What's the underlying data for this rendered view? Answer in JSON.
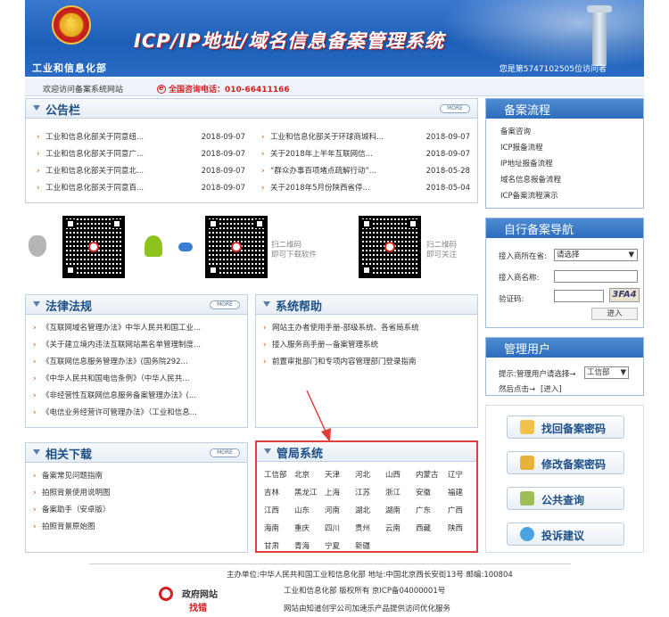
{
  "header": {
    "ministry": "工业和信息化部",
    "title": "ICP/IP地址/域名信息备案管理系统",
    "visitor": "您是第5747102505位访问者"
  },
  "welcome": {
    "text": "欢迎访问备案系统网站",
    "phone": "全国咨询电话：010-66411166"
  },
  "notice": {
    "title": "公告栏",
    "more": "MORE",
    "left": [
      {
        "t": "工业和信息化部关于同意纽...",
        "d": "2018-09-07"
      },
      {
        "t": "工业和信息化部关于同意广...",
        "d": "2018-09-07"
      },
      {
        "t": "工业和信息化部关于同意北...",
        "d": "2018-09-07"
      },
      {
        "t": "工业和信息化部关于同意百...",
        "d": "2018-09-07"
      }
    ],
    "right": [
      {
        "t": "工业和信息化部关于环球商城科...",
        "d": "2018-09-07"
      },
      {
        "t": "关于2018年上半年互联网信...",
        "d": "2018-09-07"
      },
      {
        "t": "“群众办事百项堵点疏解行动”...",
        "d": "2018-05-28"
      },
      {
        "t": "关于2018年5月份陕西省停...",
        "d": "2018-05-04"
      }
    ]
  },
  "qr": {
    "download_line1": "扫二维码",
    "download_line2": "即可下载软件",
    "follow_line1": "扫二维码",
    "follow_line2": "即可关注"
  },
  "law": {
    "title": "法律法规",
    "more": "MORE",
    "items": [
      "《互联网域名管理办法》中华人民共和国工业...",
      "《关于建立境内违法互联网站黑名单管理制度...",
      "《互联网信息服务管理办法》(国务院292...",
      "《中华人民共和国电信条例》（中华人民共...",
      "《非经营性互联网信息服务备案管理办法》(...",
      "《电信业务经营许可管理办法》（工业和信息..."
    ]
  },
  "help": {
    "title": "系统帮助",
    "items": [
      "网站主办者使用手册-部级系统、各省局系统",
      "接入服务商手册—备案管理系统",
      "前置审批部门和专项内容管理部门登录指南"
    ]
  },
  "download": {
    "title": "相关下载",
    "more": "MORE",
    "items": [
      "备案常见问题指南",
      "拍照背景使用说明图",
      "备案助手（安卓版）",
      "拍照背景原始图"
    ]
  },
  "bureau": {
    "title": "管局系统",
    "regions": [
      [
        "工信部",
        "北京",
        "天津",
        "河北",
        "山西",
        "内蒙古",
        "辽宁"
      ],
      [
        "吉林",
        "黑龙江",
        "上海",
        "江苏",
        "浙江",
        "安徽",
        "福建"
      ],
      [
        "江西",
        "山东",
        "河南",
        "湖北",
        "湖南",
        "广东",
        "广西"
      ],
      [
        "海南",
        "重庆",
        "四川",
        "贵州",
        "云南",
        "西藏",
        "陕西"
      ],
      [
        "甘肃",
        "青海",
        "宁夏",
        "新疆"
      ]
    ]
  },
  "flow": {
    "title": "备案流程",
    "items": [
      "备案咨询",
      "ICP报备流程",
      "IP地址报备流程",
      "域名信息报备流程",
      "ICP备案流程演示"
    ]
  },
  "nav": {
    "title": "自行备案导航",
    "province_label": "接入商所在省:",
    "province_value": "请选择",
    "name_label": "接入商名称:",
    "code_label": "验证码:",
    "captcha": "3FA4",
    "enter": "进入"
  },
  "manage": {
    "title": "管理用户",
    "prompt": "提示:管理用户请选择→",
    "select": "工信部",
    "after": "然后点击→",
    "enter_link": "[进入]"
  },
  "buttons": {
    "recover": "找回备案密码",
    "change": "修改备案密码",
    "query": "公共查询",
    "complain": "投诉建议"
  },
  "footer": {
    "line1": "主办单位:中华人民共和国工业和信息化部 地址:中国北京西长安街13号 邮编:100804",
    "line2": "工业和信息化部 版权所有 京ICP备04000001号",
    "line3": "网站由知道创宇公司加速乐产品提供访问优化服务",
    "gov_line1": "政府网站",
    "gov_line2": "找错"
  },
  "colors": {
    "header_blue": "#1d5fb8",
    "accent_red": "#d21f1f",
    "panel_title": "#1c4f86"
  }
}
